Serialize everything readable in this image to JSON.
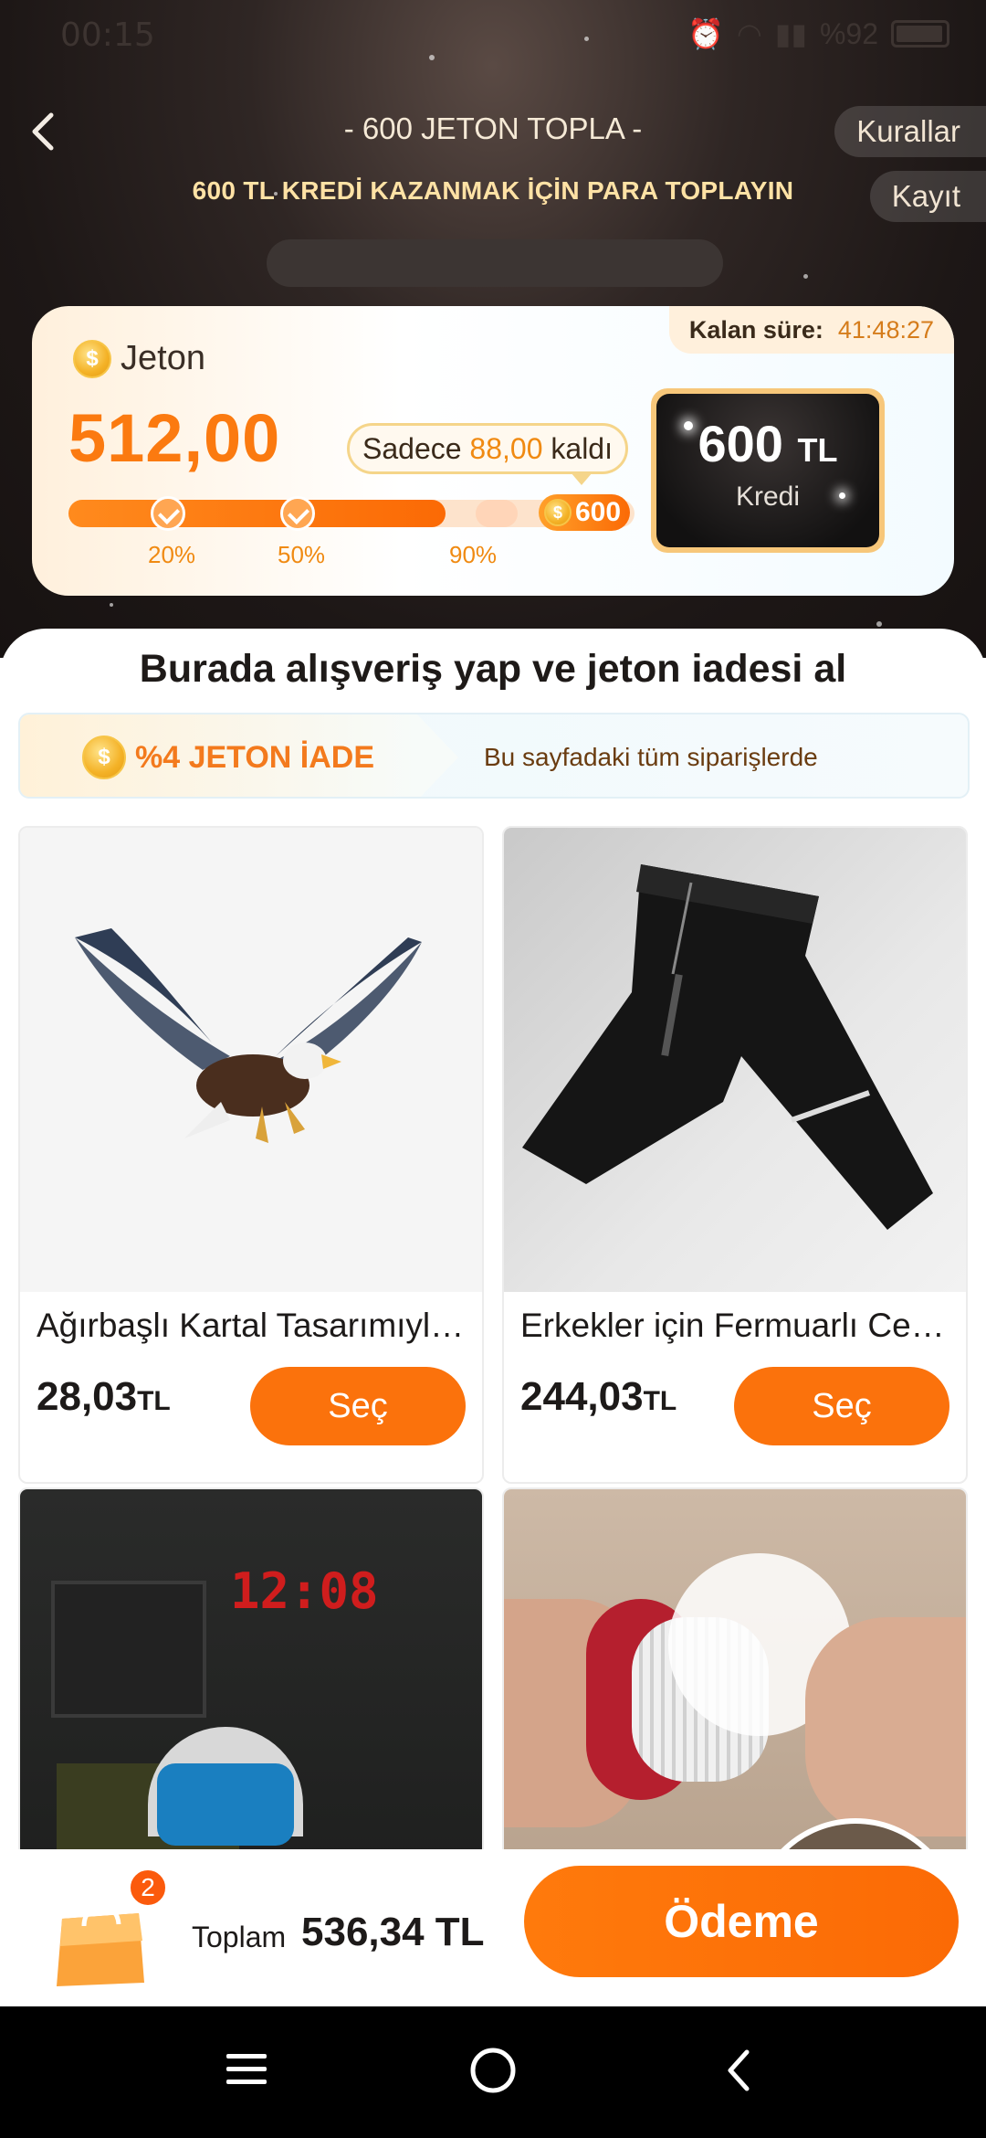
{
  "status_bar": {
    "time": "00:15",
    "battery": "%92"
  },
  "header": {
    "title": "- 600 JETON TOPLA -",
    "subtitle": "600 TL KREDİ KAZANMAK İÇİN PARA TOPLAYIN",
    "rules_label": "Kurallar",
    "records_label": "Kayıt"
  },
  "jeton_card": {
    "label": "Jeton",
    "coin_symbol": "$",
    "value": "512,00",
    "timer_label": "Kalan süre:",
    "timer_value": "41:48:27",
    "remaining_prefix": "Sadece ",
    "remaining_value": "88,00",
    "remaining_suffix": " kaldı",
    "progress_fraction": 0.853,
    "milestones": [
      {
        "label": "20%",
        "fraction": 0.2,
        "done": true
      },
      {
        "label": "50%",
        "fraction": 0.5,
        "done": true
      },
      {
        "label": "90%",
        "fraction": 0.9,
        "done": false
      }
    ],
    "goal_label": "600",
    "credit_amount": "600",
    "credit_currency": "TL",
    "credit_sub": "Kredi"
  },
  "sheet": {
    "title": "Burada alışveriş yap ve jeton iadesi al",
    "cashback_label": "%4 JETON İADE",
    "cashback_desc": "Bu sayfadaki tüm siparişlerde"
  },
  "products": [
    {
      "name": "Ağırbaşlı Kartal Tasarımıyla Araba Çıkartması",
      "price": "28,03",
      "currency": "TL",
      "button": "Seç"
    },
    {
      "name": "Erkekler için Fermuarlı Cepli Eşofman Altı",
      "price": "244,03",
      "currency": "TL",
      "button": "Seç"
    },
    {
      "name": "",
      "price": "",
      "currency": "",
      "button": ""
    },
    {
      "name": "",
      "price": "",
      "currency": "",
      "button": ""
    }
  ],
  "clock_display": "12:08",
  "checkout": {
    "cart_count": "2",
    "total_label": "Toplam",
    "total_value": "536,34 TL",
    "pay_label": "Ödeme"
  },
  "colors": {
    "accent": "#fb720c",
    "gold": "#f4b227",
    "dark_bg": "#1d1716"
  }
}
